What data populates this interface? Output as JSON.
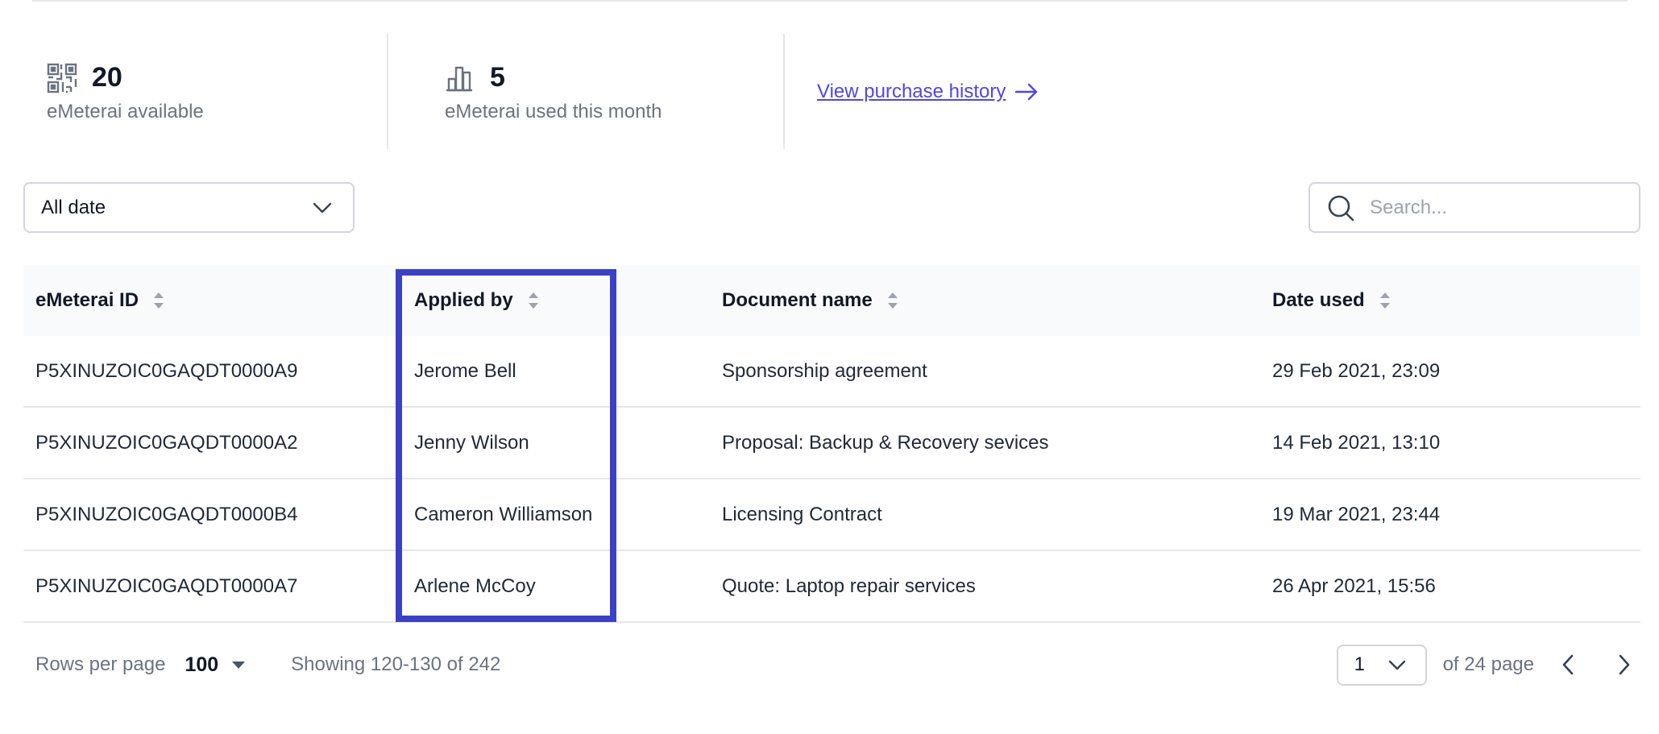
{
  "stats": {
    "available": {
      "value": "20",
      "label": "eMeterai available",
      "icon": "qr-code-icon"
    },
    "used": {
      "value": "5",
      "label": "eMeterai used this month",
      "icon": "bar-chart-icon"
    },
    "history_link": {
      "label": "View purchase history",
      "icon": "arrow-right-icon"
    }
  },
  "filters": {
    "date_select": {
      "value": "All date",
      "icon": "chevron-down-icon"
    },
    "search": {
      "placeholder": "Search...",
      "value": "",
      "icon": "search-icon"
    }
  },
  "table": {
    "columns": [
      {
        "label": "eMeterai ID"
      },
      {
        "label": "Applied by"
      },
      {
        "label": "Document name"
      },
      {
        "label": "Date used"
      }
    ],
    "rows": [
      {
        "id": "P5XINUZOIC0GAQDT0000A9",
        "applied_by": "Jerome Bell",
        "document": "Sponsorship agreement",
        "date": "29 Feb 2021, 23:09"
      },
      {
        "id": "P5XINUZOIC0GAQDT0000A2",
        "applied_by": "Jenny Wilson",
        "document": "Proposal: Backup & Recovery sevices",
        "date": "14 Feb 2021, 13:10"
      },
      {
        "id": "P5XINUZOIC0GAQDT0000B4",
        "applied_by": "Cameron Williamson",
        "document": "Licensing Contract",
        "date": "19 Mar 2021, 23:44"
      },
      {
        "id": "P5XINUZOIC0GAQDT0000A7",
        "applied_by": "Arlene McCoy",
        "document": "Quote: Laptop repair services",
        "date": "26 Apr 2021, 15:56"
      }
    ]
  },
  "footer": {
    "rows_per_page_label": "Rows per page",
    "rows_per_page_value": "100",
    "showing": "Showing 120-130 of 242",
    "page_value": "1",
    "of_pages": "of 24 page"
  },
  "colors": {
    "accent": "#4f46e5",
    "highlight_border": "#3b41c5",
    "header_bg": "#f9fafb",
    "divider": "#e5e7eb",
    "muted_text": "#6b7280"
  }
}
